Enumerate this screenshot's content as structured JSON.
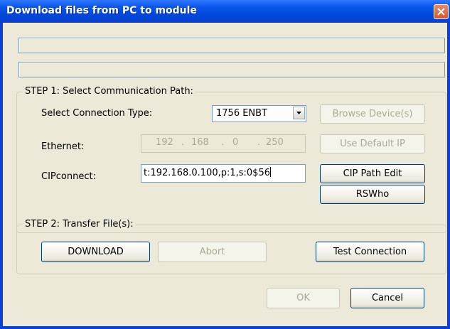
{
  "window": {
    "title": "Download files from PC to module"
  },
  "progress": {
    "bar1_fraction": 0,
    "bar2_fraction": 0,
    "bar_color": "#2fb24a"
  },
  "step1": {
    "title": "STEP 1: Select Communication Path:",
    "connection_type_label": "Select Connection Type:",
    "connection_type_value": "1756 ENBT",
    "browse_label": "Browse Device(s)",
    "ethernet_label": "Ethernet:",
    "ip_octets": [
      "192",
      "168",
      "0",
      "250"
    ],
    "use_default_ip_label": "Use Default IP",
    "cipconnect_label": "CIPconnect:",
    "cipconnect_value": "t:192.168.0.100,p:1,s:0$56",
    "cip_path_edit_label": "CIP Path Edit",
    "rswho_label": "RSWho"
  },
  "step2": {
    "title": "STEP 2: Transfer File(s):",
    "download_label": "DOWNLOAD",
    "abort_label": "Abort",
    "test_connection_label": "Test Connection"
  },
  "footer": {
    "ok_label": "OK",
    "cancel_label": "Cancel"
  }
}
